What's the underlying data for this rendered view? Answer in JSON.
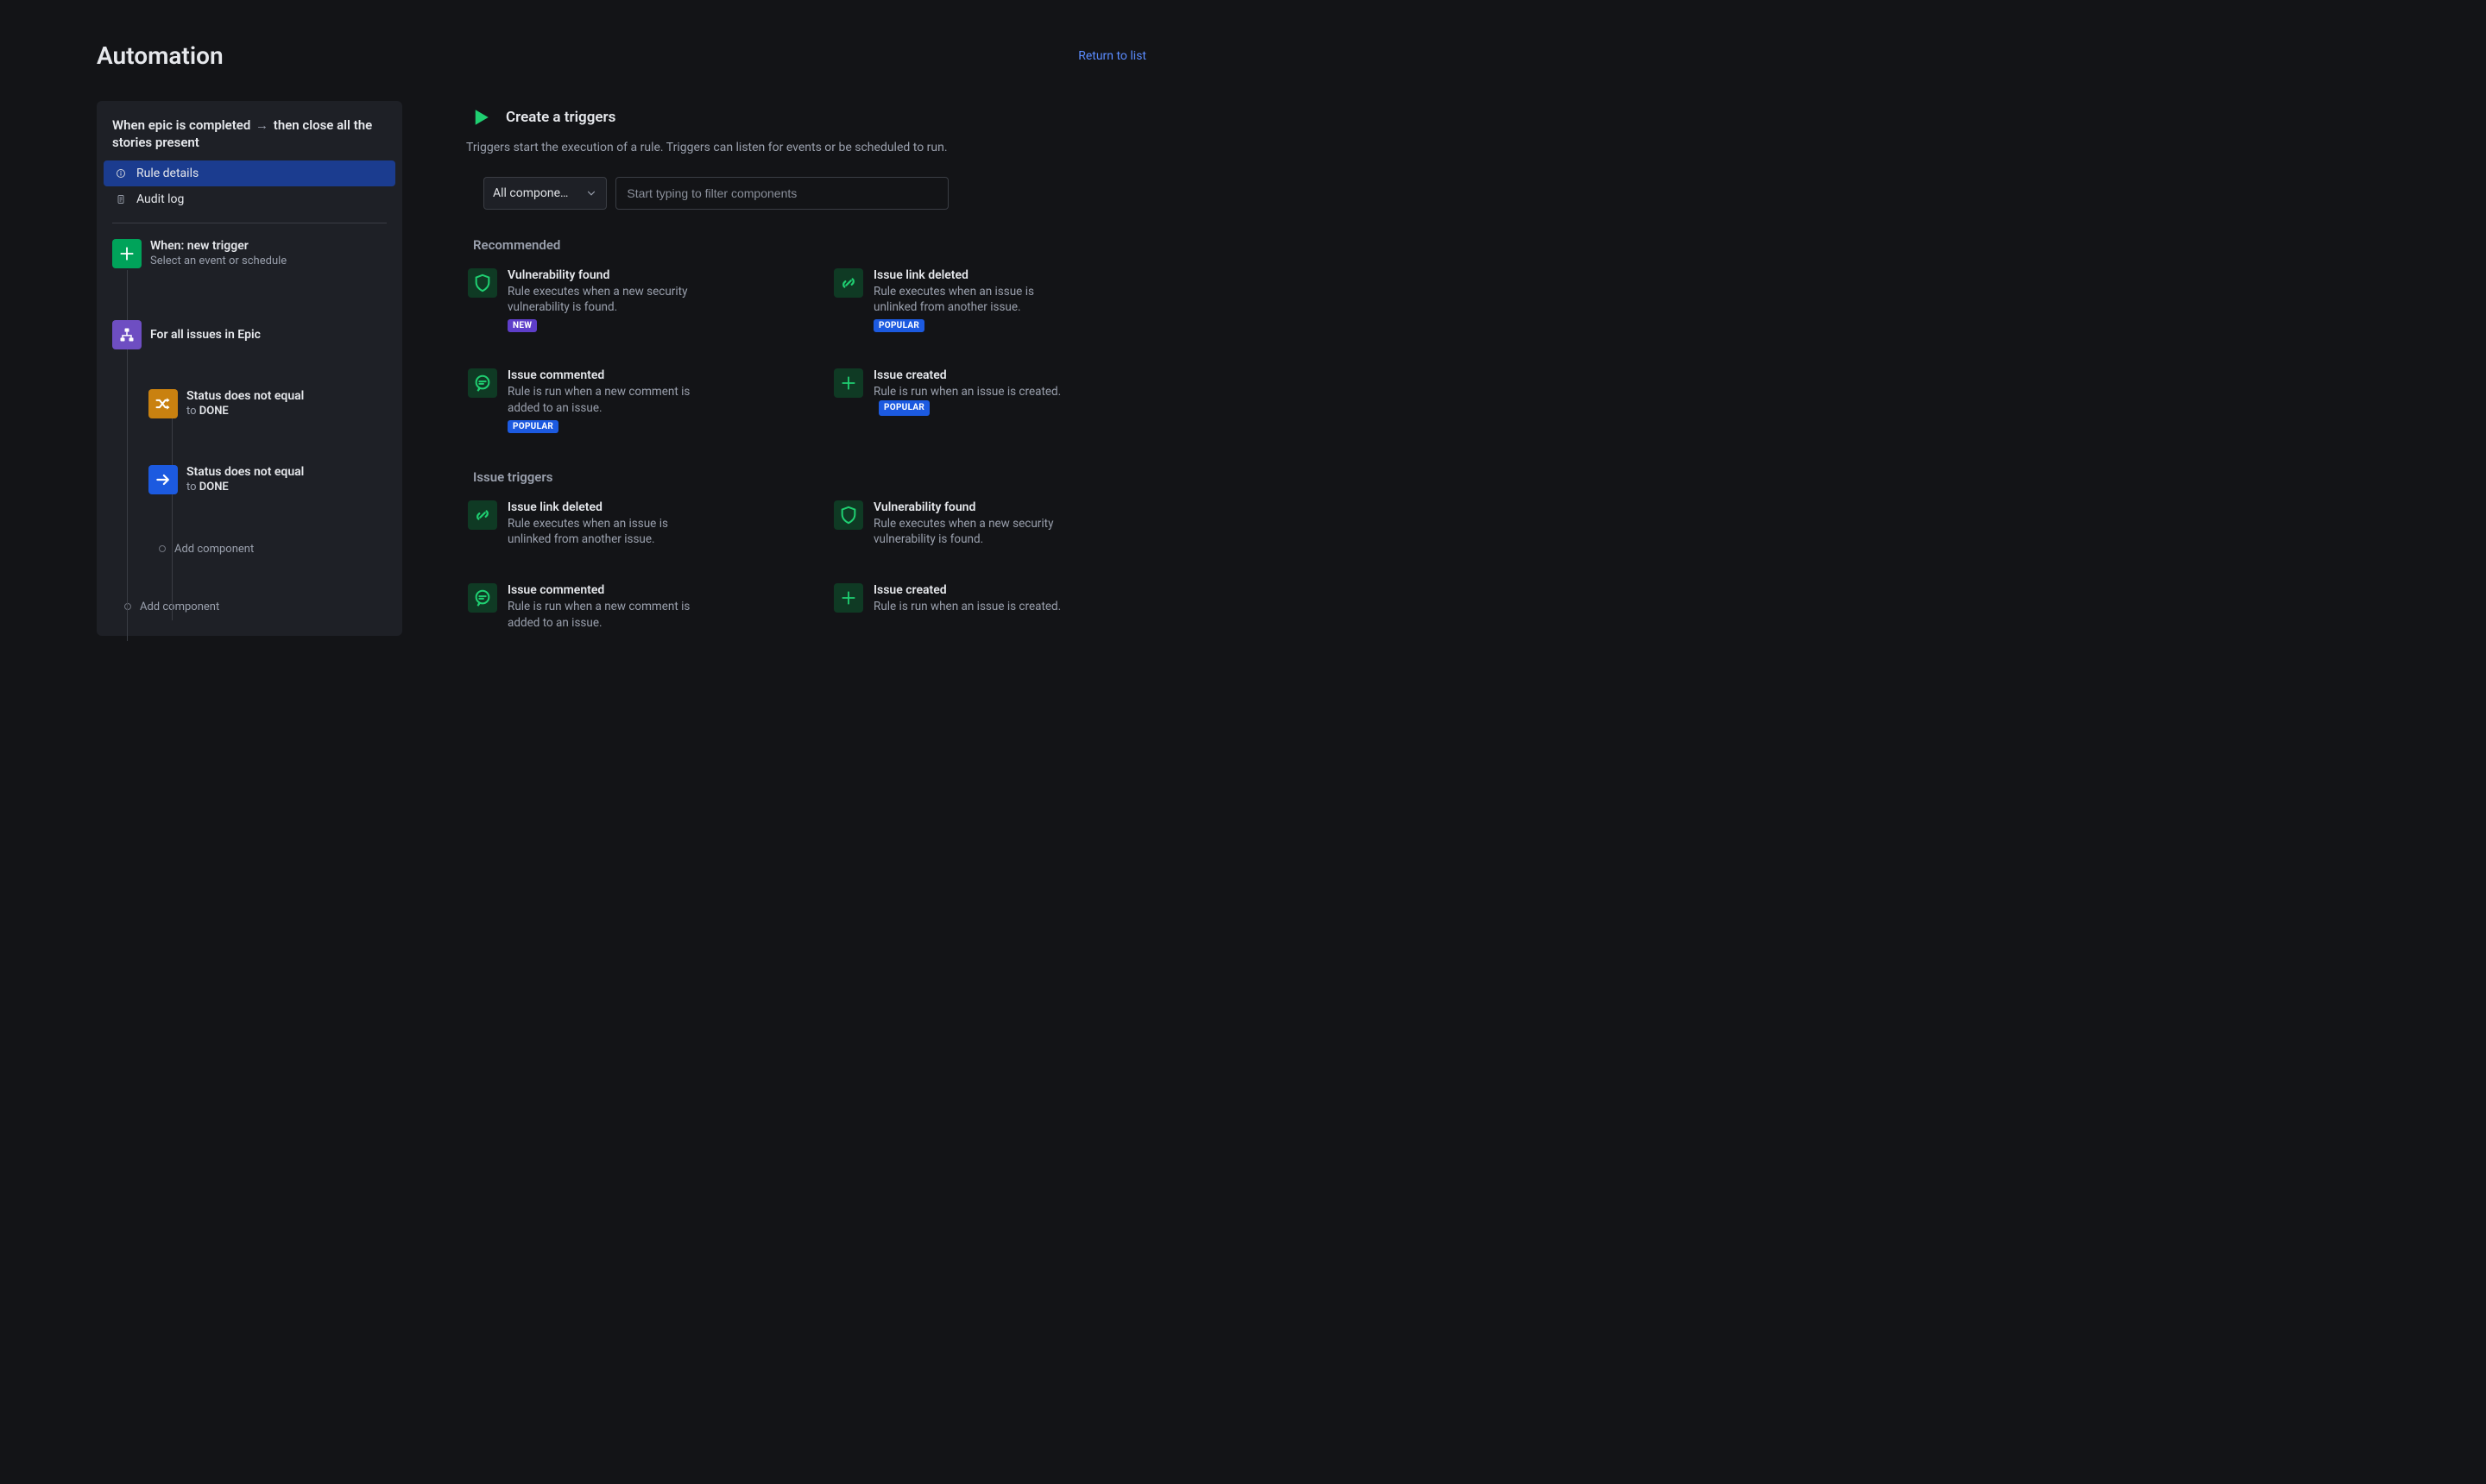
{
  "page_title": "Automation",
  "return_link": "Return to list",
  "rule": {
    "name_before": "When epic is completed",
    "name_after": "then close all the stories present"
  },
  "nav": {
    "rule_details": "Rule details",
    "audit_log": "Audit log"
  },
  "tree": {
    "trigger": {
      "title": "When: new trigger",
      "sub": "Select an event or schedule"
    },
    "branch": {
      "title": "For all issues in Epic"
    },
    "cond1": {
      "title": "Status does not equal",
      "sub_prefix": "to ",
      "sub_val": "DONE"
    },
    "cond2": {
      "title": "Status does not equal",
      "sub_prefix": "to ",
      "sub_val": "DONE"
    },
    "add_inner": "Add component",
    "add_outer": "Add component"
  },
  "main": {
    "title": "Create a triggers",
    "sub": "Triggers start the execution of a rule. Triggers can listen for events or be scheduled to run."
  },
  "filters": {
    "select_label": "All compone…",
    "search_placeholder": "Start typing to filter components"
  },
  "sections": {
    "recommended": "Recommended",
    "issue_triggers": "Issue triggers"
  },
  "recommended": [
    {
      "icon": "shield",
      "title": "Vulnerability found",
      "sub": "Rule executes when a new security vulnerability is found.",
      "badge": "NEW",
      "badge_kind": "new"
    },
    {
      "icon": "unlink",
      "title": "Issue link deleted",
      "sub": "Rule executes when an issue is unlinked from another issue.",
      "badge": "POPULAR"
    },
    {
      "icon": "comment",
      "title": "Issue commented",
      "sub": "Rule is run when a new comment is added to an issue.",
      "badge": "POPULAR"
    },
    {
      "icon": "plus",
      "title": "Issue created",
      "sub": "Rule is run when an issue is created.",
      "badge": "POPULAR",
      "inline_badge": true
    }
  ],
  "issue_triggers": [
    {
      "icon": "unlink",
      "title": "Issue link deleted",
      "sub": "Rule executes when an issue is unlinked from another issue."
    },
    {
      "icon": "shield",
      "title": "Vulnerability found",
      "sub": "Rule executes when a new security vulnerability is found."
    },
    {
      "icon": "comment",
      "title": "Issue commented",
      "sub": "Rule is run when a new comment is added to an issue."
    },
    {
      "icon": "plus",
      "title": "Issue created",
      "sub": "Rule is run when an issue is created."
    }
  ]
}
